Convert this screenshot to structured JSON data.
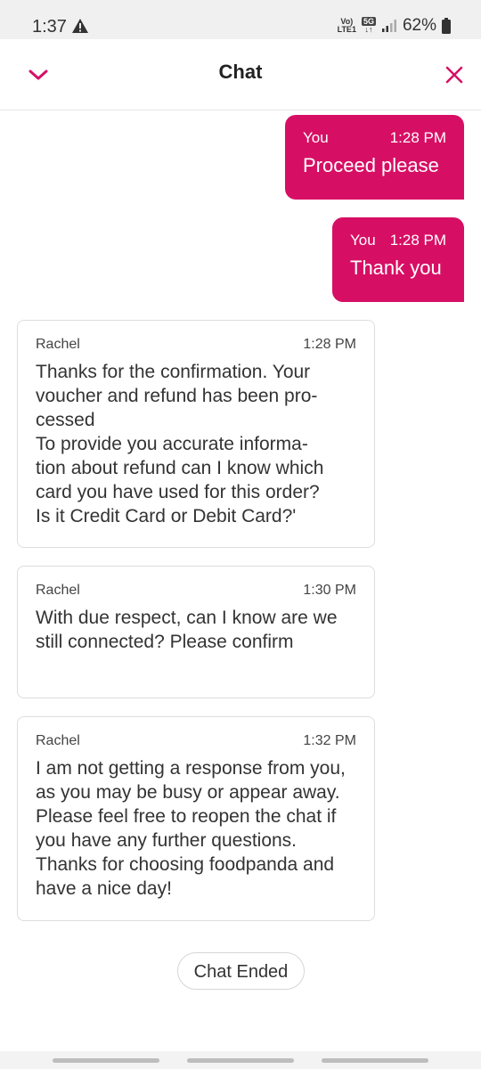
{
  "status": {
    "time": "1:37",
    "volte_top": "Vo)",
    "volte_bottom": "LTE1",
    "net_top": "5G",
    "net_bottom": "↓↑",
    "battery": "62%"
  },
  "header": {
    "title": "Chat"
  },
  "messages_out": [
    {
      "sender": "You",
      "time": "1:28 PM",
      "text": "Proceed please"
    },
    {
      "sender": "You",
      "time": "1:28 PM",
      "text": "Thank you"
    }
  ],
  "messages_in": [
    {
      "sender": "Rachel",
      "time": "1:28 PM",
      "text": "Thanks for the confirmation. Your voucher and refund has been pro-\ncessed\nTo provide you accurate informa-\ntion about refund can I know which card you have used for this order?\nIs it Credit Card or Debit Card?'"
    },
    {
      "sender": "Rachel",
      "time": "1:30 PM",
      "text": "With due respect, can I know are we still connected? Please confirm"
    },
    {
      "sender": "Rachel",
      "time": "1:32 PM",
      "text": "I am not getting a response from you, as you may be busy or appear away. Please feel free to reopen the chat if you have any further questions. Thanks for choosing foodpanda and have a nice day!"
    }
  ],
  "footer": {
    "chat_ended": "Chat Ended"
  },
  "colors": {
    "brand": "#d70f64"
  }
}
